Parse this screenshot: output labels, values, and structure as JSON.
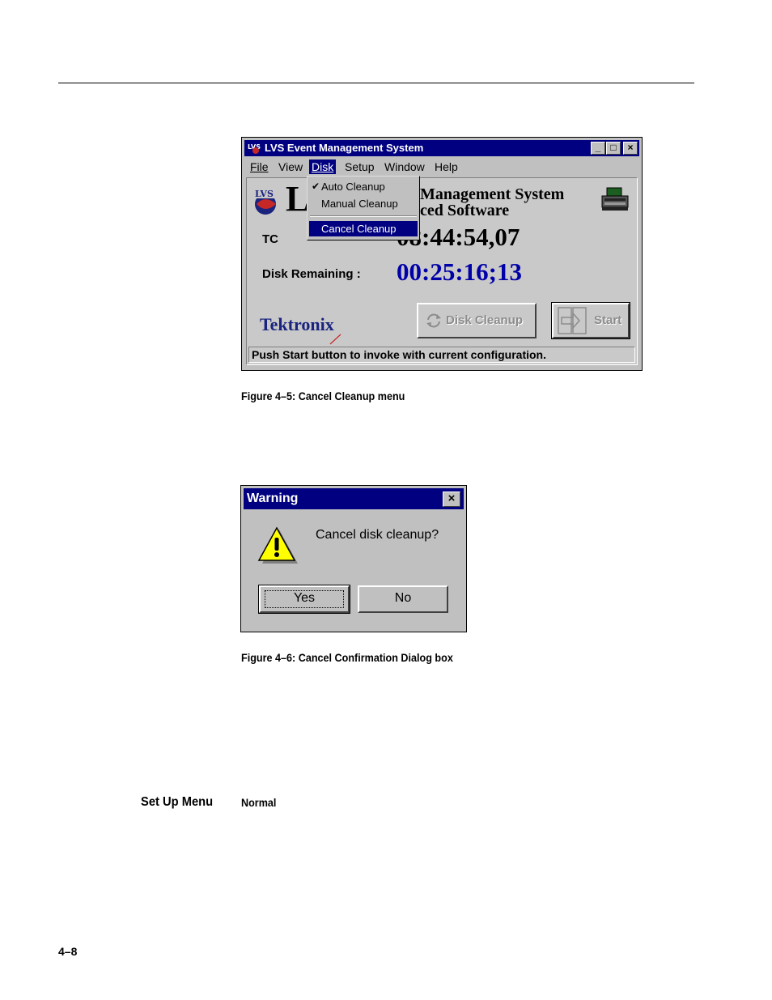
{
  "figure1": {
    "window_title": "LVS Event Management System",
    "window_buttons": {
      "minimize": "_",
      "maximize": "□",
      "close": "×"
    },
    "menu": [
      "File",
      "View",
      "Disk",
      "Setup",
      "Window",
      "Help"
    ],
    "active_menu": "Disk",
    "disk_menu": {
      "items": [
        {
          "label": "Auto Cleanup",
          "checked": true
        },
        {
          "label": "Manual Cleanup",
          "checked": false
        },
        {
          "label": "Cancel Cleanup",
          "checked": false,
          "highlighted": true
        }
      ]
    },
    "logo_text": "LVS",
    "app_title_line1": "Management System",
    "app_title_line2": "ced Software",
    "app_title_initial": "L",
    "tc_label": "TC",
    "tc_colon": ":",
    "tc_value": "08:44:54,07",
    "disk_remaining_label": "Disk Remaining  :",
    "disk_remaining_value": "00:25:16;13",
    "brand": "Tektronix",
    "disk_cleanup_button": "Disk Cleanup",
    "start_button": "Start",
    "status_text": "Push Start button to invoke with current configuration.",
    "colors": {
      "titlebar": "#000080",
      "disk_value": "#0000a8"
    },
    "icons": [
      "lvs-app-icon",
      "lvs-globe-logo-icon",
      "printer-icon",
      "recycle-icon",
      "start-door-icon",
      "check-icon"
    ]
  },
  "figure1_caption": "Figure 4–5: Cancel Cleanup menu",
  "figure2": {
    "title": "Warning",
    "close": "×",
    "message": "Cancel disk cleanup?",
    "yes_button": "Yes",
    "no_button": "No",
    "icons": [
      "warning-icon",
      "close-icon"
    ]
  },
  "figure2_caption": "Figure 4–6: Cancel Confirmation Dialog box",
  "section_heading": "Set Up Menu",
  "section_normal": "Normal",
  "page_number": "4–8"
}
